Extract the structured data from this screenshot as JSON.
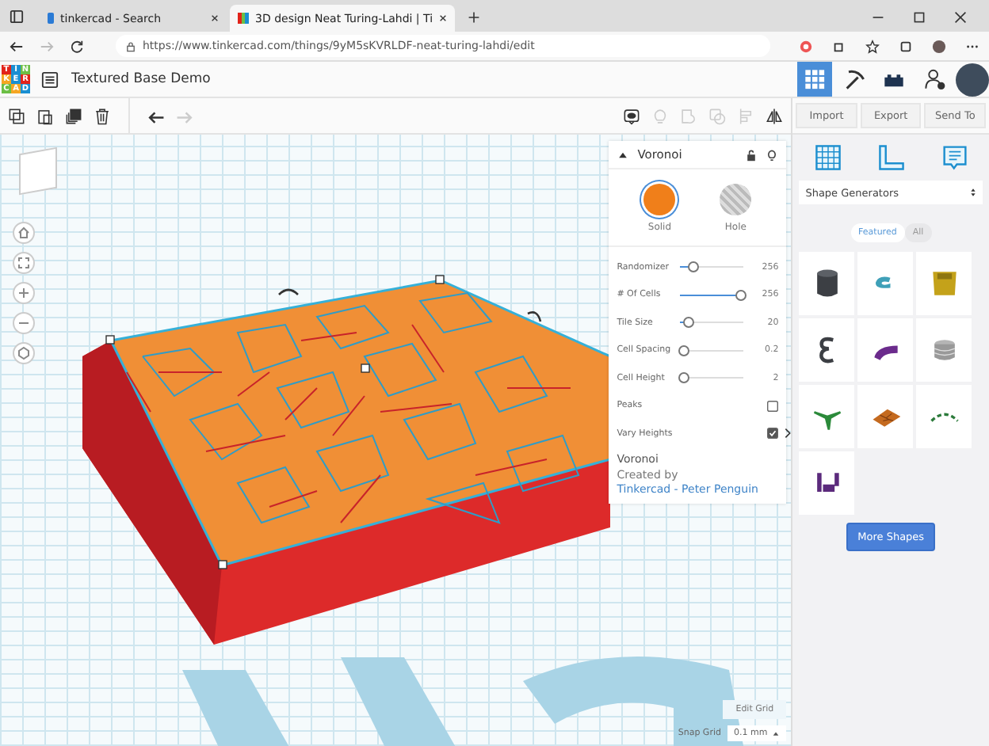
{
  "browser": {
    "tabs": [
      {
        "label": "tinkercad - Search",
        "selected": false
      },
      {
        "label": "3D design Neat Turing-Lahdi | Ti",
        "selected": true
      }
    ],
    "url": "https://www.tinkercad.com/things/9yM5sKVRLDF-neat-turing-lahdi/edit"
  },
  "app": {
    "logo_letters": [
      "T",
      "I",
      "N",
      "K",
      "E",
      "R",
      "C",
      "A",
      "D"
    ],
    "title": "Textured Base Demo",
    "views": [
      {
        "kind": "grid",
        "selected": true
      },
      {
        "kind": "pickaxe",
        "selected": false
      },
      {
        "kind": "bricks",
        "selected": false
      }
    ]
  },
  "toolbar": [
    {
      "kind": "copy",
      "disabled": false
    },
    {
      "kind": "paste",
      "disabled": false
    },
    {
      "kind": "duplicate",
      "disabled": false
    },
    {
      "kind": "delete",
      "disabled": false
    },
    {
      "kind": "undo",
      "disabled": false
    },
    {
      "kind": "redo",
      "disabled": true
    },
    {
      "kind": "notes",
      "disabled": false
    },
    {
      "kind": "bulb",
      "disabled": true
    },
    {
      "kind": "group",
      "disabled": true
    },
    {
      "kind": "ungroup",
      "disabled": true
    },
    {
      "kind": "align",
      "disabled": true
    },
    {
      "kind": "mirror",
      "disabled": false
    }
  ],
  "actions": [
    "Import",
    "Export",
    "Send To"
  ],
  "inspector": {
    "title": "Voronoi",
    "modes": [
      {
        "label": "Solid",
        "selected": true
      },
      {
        "label": "Hole",
        "selected": false
      }
    ],
    "params": [
      {
        "kind": "slider",
        "label": "Randomizer",
        "level": 0.21,
        "value": "256"
      },
      {
        "kind": "slider",
        "label": "# Of Cells",
        "level": 0.96,
        "value": "256"
      },
      {
        "kind": "slider",
        "label": "Tile Size",
        "level": 0.14,
        "value": "20"
      },
      {
        "kind": "slider",
        "label": "Cell Spacing",
        "level": 0.08,
        "value": "0.2"
      },
      {
        "kind": "slider",
        "label": "Cell Height",
        "level": 0.08,
        "value": "2"
      },
      {
        "kind": "checkbox",
        "label": "Peaks",
        "checked": false
      },
      {
        "kind": "checkbox",
        "label": "Vary Heights",
        "checked": true
      }
    ],
    "footer_title": "Voronoi",
    "credit_prefix": "Created by ",
    "credit_link": "Tinkercad - Peter Penguin"
  },
  "workplane": {
    "edit_grid": "Edit Grid",
    "snap_label": "Snap Grid",
    "snap_value": "0.1 mm"
  },
  "sidebar": {
    "category": "Shape Generators",
    "filters": [
      {
        "label": "Featured",
        "selected": true
      },
      {
        "label": "All",
        "selected": false
      }
    ],
    "shapes": [
      {
        "kind": "cylinder"
      },
      {
        "kind": "hook"
      },
      {
        "kind": "box"
      },
      {
        "kind": "spring"
      },
      {
        "kind": "pipe"
      },
      {
        "kind": "thread"
      },
      {
        "kind": "tripod"
      },
      {
        "kind": "tile"
      },
      {
        "kind": "arc"
      },
      {
        "kind": "figure"
      }
    ],
    "more": "More Shapes"
  }
}
